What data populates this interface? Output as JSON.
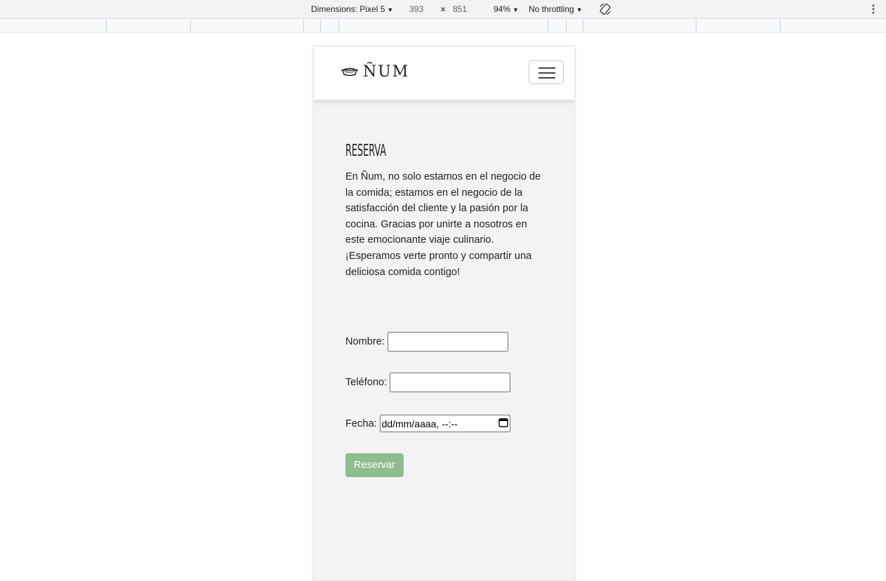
{
  "devtools": {
    "dimensions_label": "Dimensions: Pixel 5",
    "width": "393",
    "times_symbol": "×",
    "height": "851",
    "zoom": "94%",
    "throttling": "No throttling"
  },
  "navbar": {
    "brand": "ÑUM",
    "logo_icon": "cooking-pot-icon",
    "menu_icon": "hamburger-menu-icon"
  },
  "main": {
    "title": "RESERVA",
    "intro": "En Ñum, no solo estamos en el negocio de la comida; estamos en el negocio de la satisfacción del cliente y la pasión por la cocina. Gracias por unirte a nosotros en este emocionante viaje culinario. ¡Esperamos verte pronto y compartir una deliciosa comida contigo!"
  },
  "form": {
    "name_label": "Nombre:",
    "name_value": "",
    "phone_label": "Teléfono:",
    "phone_value": "",
    "date_label": "Fecha:",
    "date_placeholder": "dd/mm/aaaa, --:--",
    "submit_label": "Reservar",
    "submit_color": "#8fbc8f"
  }
}
